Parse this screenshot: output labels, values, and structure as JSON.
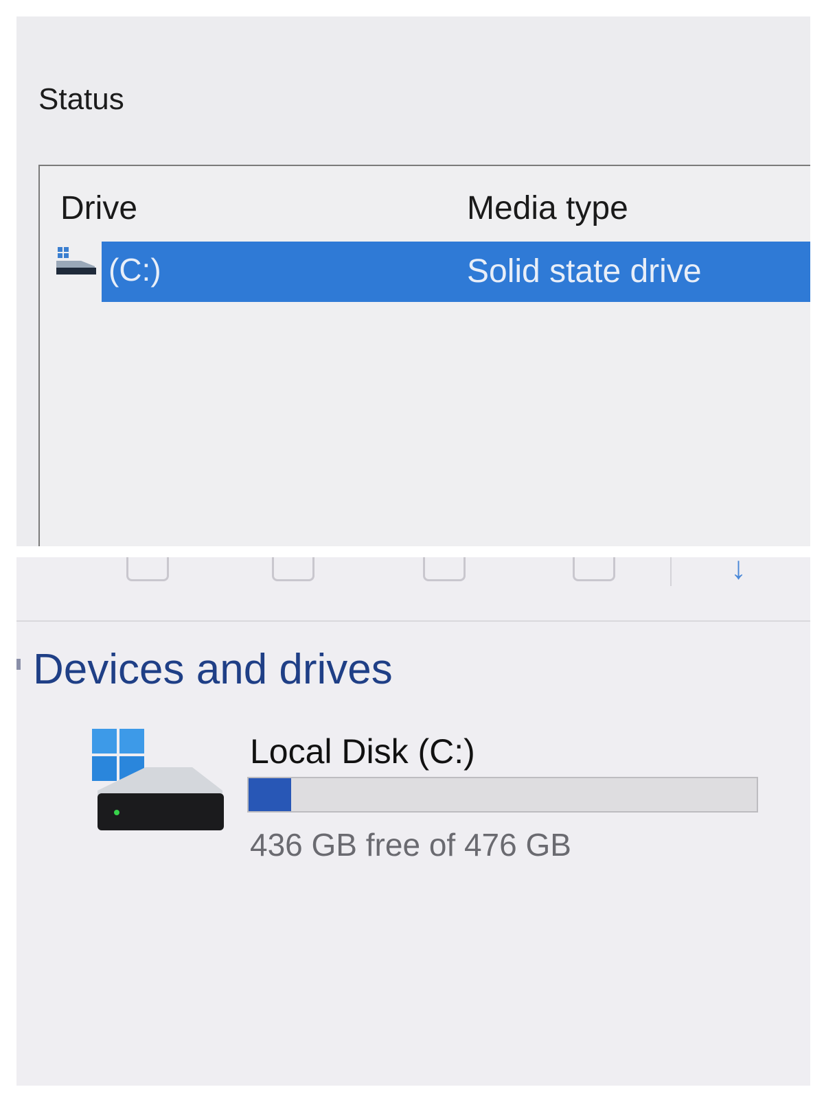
{
  "status_panel": {
    "title": "Status",
    "columns": [
      "Drive",
      "Media type"
    ],
    "rows": [
      {
        "icon": "ssd-drive-icon",
        "drive": "(C:)",
        "media_type": "Solid state drive",
        "selected": true
      }
    ]
  },
  "explorer_panel": {
    "toolbar_icons": [
      "copy-icon",
      "paste-icon",
      "share-icon",
      "delete-icon",
      "sort-icon"
    ],
    "group_header": "Devices and drives",
    "drives": [
      {
        "icon": "windows-drive-icon",
        "name": "Local Disk (C:)",
        "free_text": "436 GB free of 476 GB",
        "used_fraction": 0.084
      }
    ]
  },
  "colors": {
    "selection": "#2f7ad6",
    "usage_bar": "#2857b6",
    "group_header": "#1f3f86"
  }
}
